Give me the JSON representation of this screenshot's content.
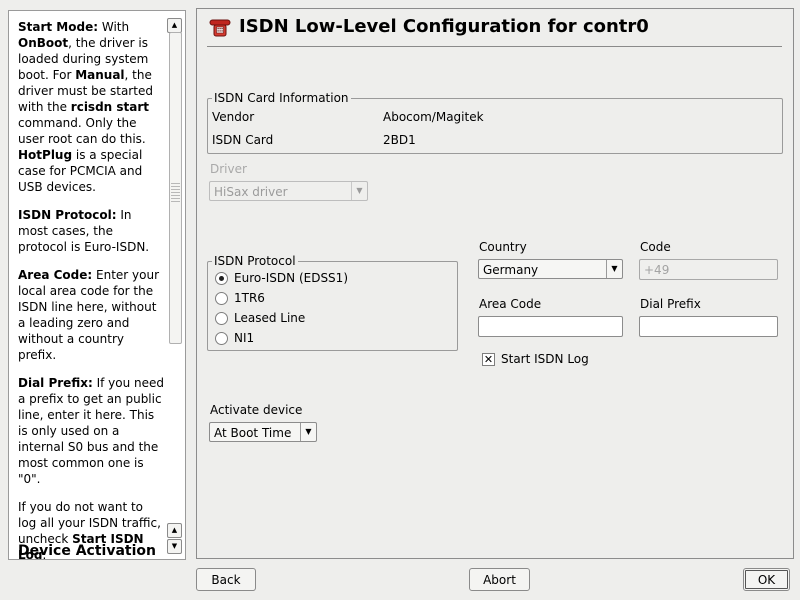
{
  "help": {
    "paragraphs": [
      [
        {
          "t": "Start Mode:",
          "b": true
        },
        {
          "t": " With "
        },
        {
          "t": "OnBoot",
          "b": true
        },
        {
          "t": ", the driver is loaded during system boot. For "
        },
        {
          "t": "Manual",
          "b": true
        },
        {
          "t": ", the driver must be started with the "
        },
        {
          "t": "rcisdn start",
          "b": true
        },
        {
          "t": " command. Only the user root can do this. "
        },
        {
          "t": "HotPlug",
          "b": true
        },
        {
          "t": " is a special case for PCMCIA and USB devices."
        }
      ],
      [
        {
          "t": "ISDN Protocol:",
          "b": true
        },
        {
          "t": " In most cases, the protocol is Euro-ISDN."
        }
      ],
      [
        {
          "t": "Area Code:",
          "b": true
        },
        {
          "t": " Enter your local area code for the ISDN line here, without a leading zero and without a country prefix."
        }
      ],
      [
        {
          "t": "Dial Prefix:",
          "b": true
        },
        {
          "t": " If you need a prefix to get an public line, enter it here. This is only used on a internal S0 bus and the most common one is \"0\"."
        }
      ],
      [
        {
          "t": "If you do not want to log all your ISDN traffic, uncheck "
        },
        {
          "t": "Start ISDN Log",
          "b": true
        },
        {
          "t": "."
        }
      ]
    ],
    "bottom_heading": "Device Activation"
  },
  "header": {
    "title": "ISDN Low-Level Configuration for contr0",
    "icon": "telephone-icon",
    "icon_color": "#c0261f"
  },
  "card_info": {
    "legend": "ISDN Card Information",
    "rows": [
      {
        "label": "Vendor",
        "value": "Abocom/Magitek"
      },
      {
        "label": "ISDN Card",
        "value": "2BD1"
      }
    ]
  },
  "driver": {
    "label": "Driver",
    "selected": "HiSax driver",
    "enabled": false
  },
  "protocol": {
    "legend": "ISDN Protocol",
    "options": [
      {
        "label": "Euro-ISDN (EDSS1)",
        "selected": true
      },
      {
        "label": "1TR6",
        "selected": false
      },
      {
        "label": "Leased Line",
        "selected": false
      },
      {
        "label": "NI1",
        "selected": false
      }
    ]
  },
  "country": {
    "label": "Country",
    "selected": "Germany"
  },
  "code": {
    "label": "Code",
    "value": "+49",
    "enabled": false
  },
  "area_code": {
    "label": "Area Code",
    "value": ""
  },
  "dial_prefix": {
    "label": "Dial Prefix",
    "value": ""
  },
  "isdn_log": {
    "label": "Start ISDN Log",
    "checked": true
  },
  "activate": {
    "label": "Activate device",
    "selected": "At Boot Time"
  },
  "buttons": {
    "back": "Back",
    "abort": "Abort",
    "ok": "OK"
  }
}
